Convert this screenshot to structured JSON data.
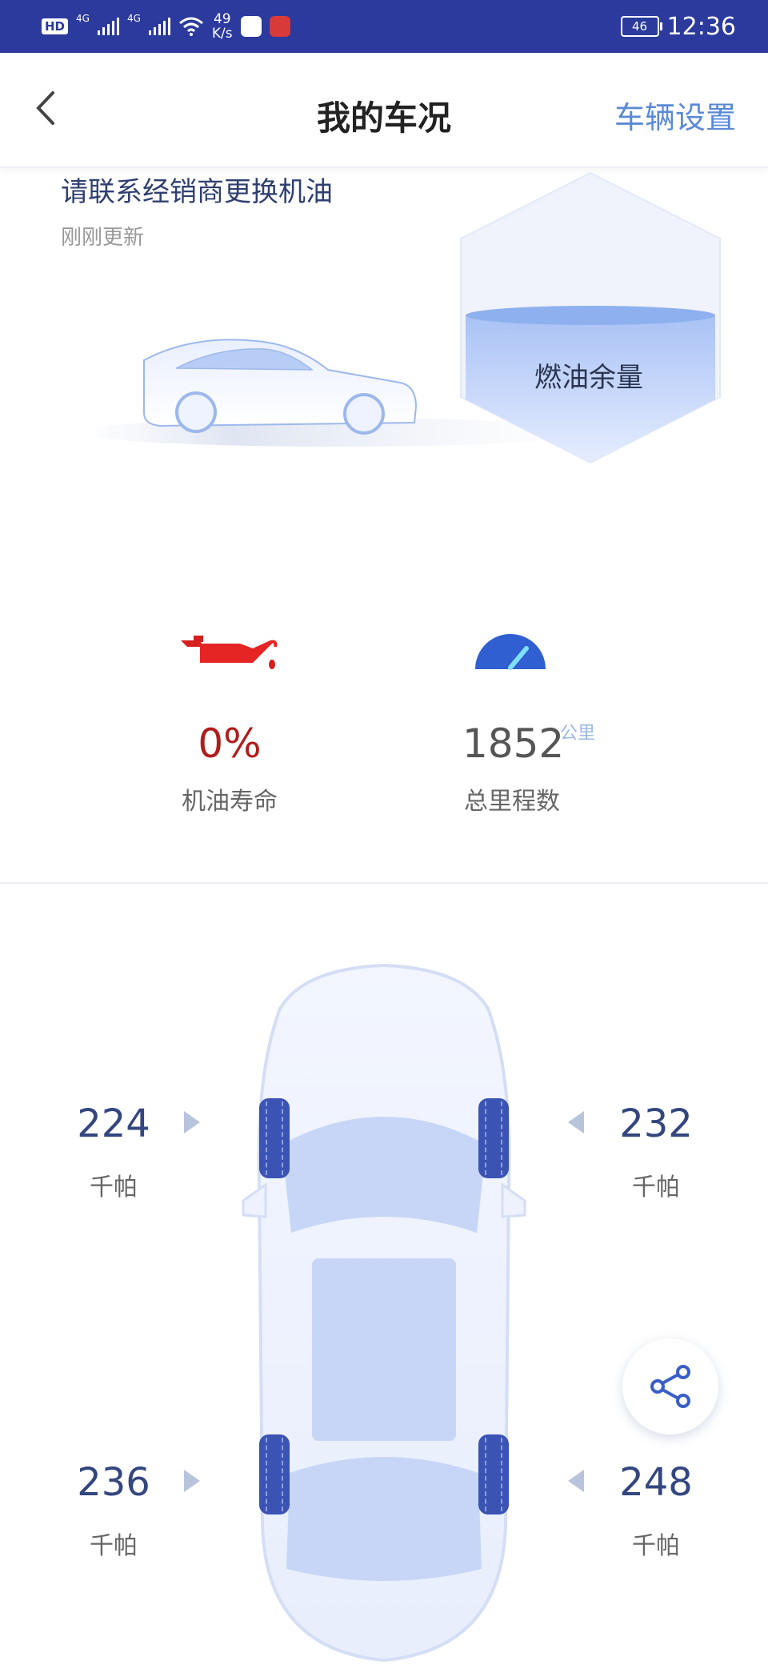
{
  "status_bar": {
    "hd_badge": "HD",
    "net1": "4G",
    "net2": "4G",
    "speed_value": "49",
    "speed_unit": "K/s",
    "battery": "46",
    "time": "12:36"
  },
  "nav": {
    "title": "我的车况",
    "settings_label": "车辆设置"
  },
  "alert": {
    "title": "请联系经销商更换机油",
    "subtitle": "刚刚更新"
  },
  "fuel": {
    "label": "燃油余量"
  },
  "stats": {
    "oil_value": "0%",
    "oil_label": "机油寿命",
    "odometer_value": "1852",
    "odometer_unit": "公里",
    "odometer_label": "总里程数"
  },
  "tires": {
    "front_left": {
      "value": "224",
      "unit": "千帕"
    },
    "front_right": {
      "value": "232",
      "unit": "千帕"
    },
    "rear_left": {
      "value": "236",
      "unit": "千帕"
    },
    "rear_right": {
      "value": "248",
      "unit": "千帕"
    }
  },
  "icons": {
    "back": "chevron-left-icon",
    "oil": "oil-can-icon",
    "gauge": "speedometer-icon",
    "share": "share-icon"
  },
  "colors": {
    "status_bar": "#2b3a9c",
    "accent": "#5a8ad6",
    "warning": "#b01d1d",
    "tire": "#3b53b3"
  }
}
